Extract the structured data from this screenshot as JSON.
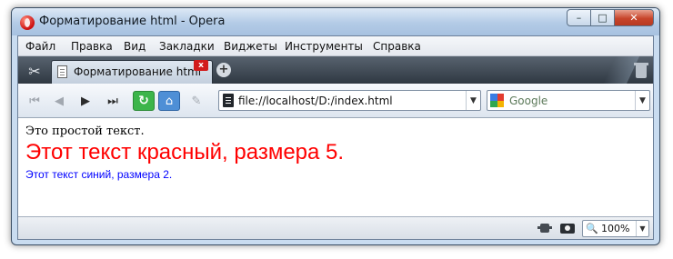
{
  "window": {
    "title": "Форматирование html - Opera",
    "controls": {
      "minimize": "–",
      "maximize": "□",
      "close": "✕"
    }
  },
  "menu": [
    "Файл",
    "Правка",
    "Вид",
    "Закладки",
    "Виджеты",
    "Инструменты",
    "Справка"
  ],
  "tabs": [
    {
      "label": "Форматирование html",
      "close": "x",
      "active": true
    }
  ],
  "toolbar": {
    "icons": {
      "rewind": "⏮",
      "back": "◀",
      "forward": "▶",
      "fast_forward": "⏭",
      "reload": "↻",
      "home": "⌂",
      "edit": "✎"
    },
    "new_tab": "+",
    "tools": "✂"
  },
  "address": {
    "url": "file://localhost/D:/index.html",
    "dropdown": "▼"
  },
  "search": {
    "engine": "Google",
    "dropdown": "▼"
  },
  "content": {
    "line1": "Это простой текст.",
    "line2": "Этот текст красный, размера 5.",
    "line3": "Этот текст синий, размера 2.",
    "colors": {
      "line2": "#ff0000",
      "line3": "#0000ff"
    }
  },
  "status": {
    "zoom": "100%",
    "zoom_icon": "🔍",
    "dropdown": "▼"
  }
}
